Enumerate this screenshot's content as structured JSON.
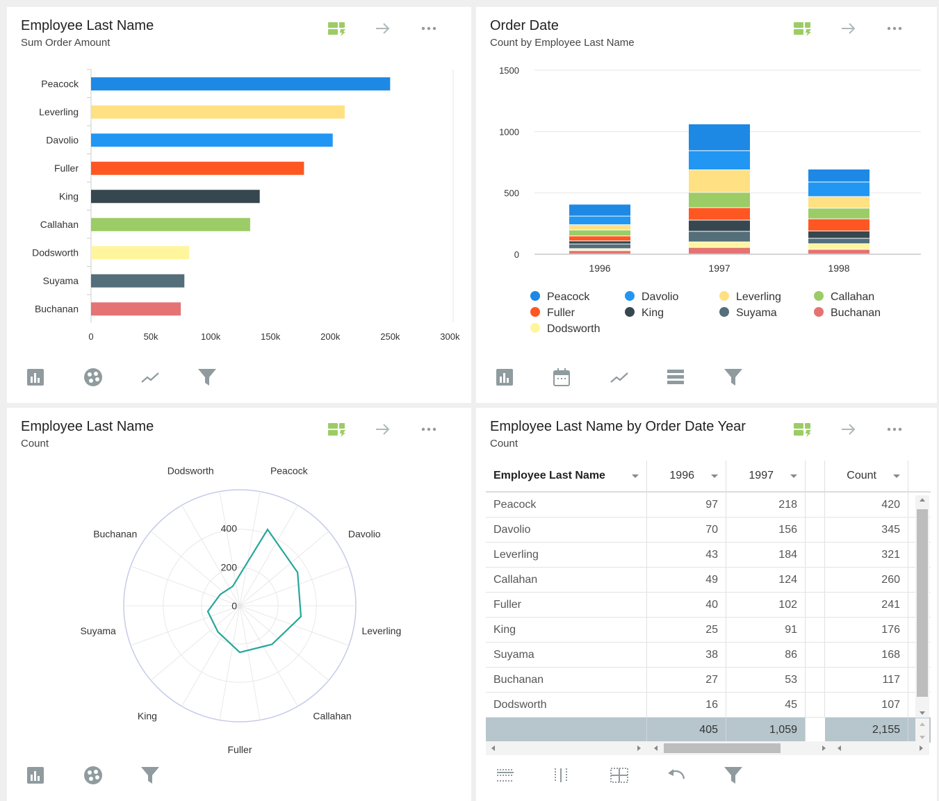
{
  "colors": {
    "Peacock": "#1e88e5",
    "Leverling": "#ffe082",
    "Davolio": "#2196f3",
    "Fuller": "#ff5722",
    "King": "#37474f",
    "Callahan": "#9ccc65",
    "Dodsworth": "#fff59d",
    "Suyama": "#546e7a",
    "Buchanan": "#e57373",
    "radar": "#26a69a",
    "icon": "#8f9b9e",
    "icon_accent": "#9ccc65"
  },
  "icons": {
    "header": [
      "visualization-settings-icon",
      "arrow-right-icon",
      "more-options-icon"
    ],
    "p1_footer": [
      "chart-type-icon",
      "palette-icon",
      "trend-icon",
      "filter-icon"
    ],
    "p2_footer": [
      "chart-type-icon",
      "calendar-icon",
      "trend-icon",
      "stack-icon",
      "filter-icon"
    ],
    "p3_footer": [
      "chart-type-icon",
      "palette-icon",
      "filter-icon"
    ],
    "p4_footer": [
      "row-grand-total-icon",
      "column-grand-total-icon",
      "grid-total-icon",
      "undo-icon",
      "filter-icon"
    ]
  },
  "panel1": {
    "title": "Employee Last Name",
    "subtitle": "Sum Order Amount",
    "chart_data": {
      "type": "bar",
      "orientation": "horizontal",
      "categories": [
        "Peacock",
        "Leverling",
        "Davolio",
        "Fuller",
        "King",
        "Callahan",
        "Dodsworth",
        "Suyama",
        "Buchanan"
      ],
      "values": [
        250000,
        212000,
        202000,
        178000,
        141000,
        133000,
        82000,
        78000,
        75000
      ],
      "xticks": [
        "0",
        "50k",
        "100k",
        "150k",
        "200k",
        "250k",
        "300k"
      ],
      "xlim": [
        0,
        300000
      ],
      "grid": false
    }
  },
  "panel2": {
    "title": "Order Date",
    "subtitle": "Count by Employee Last Name",
    "chart_data": {
      "type": "bar",
      "stacked": true,
      "categories": [
        "1996",
        "1997",
        "1998"
      ],
      "yticks": [
        "0",
        "500",
        "1000",
        "1500"
      ],
      "ylim": [
        0,
        1500
      ],
      "grid": true,
      "legend_position": "bottom",
      "series": [
        {
          "name": "Buchanan",
          "values": [
            27,
            53,
            37
          ]
        },
        {
          "name": "Dodsworth",
          "values": [
            16,
            45,
            46
          ]
        },
        {
          "name": "Suyama",
          "values": [
            38,
            86,
            44
          ]
        },
        {
          "name": "King",
          "values": [
            25,
            91,
            60
          ]
        },
        {
          "name": "Fuller",
          "values": [
            40,
            102,
            99
          ]
        },
        {
          "name": "Callahan",
          "values": [
            49,
            124,
            87
          ]
        },
        {
          "name": "Leverling",
          "values": [
            43,
            184,
            94
          ]
        },
        {
          "name": "Davolio",
          "values": [
            70,
            156,
            119
          ]
        },
        {
          "name": "Peacock",
          "values": [
            97,
            218,
            105
          ]
        }
      ],
      "legend": [
        "Peacock",
        "Davolio",
        "Leverling",
        "Callahan",
        "Fuller",
        "King",
        "Suyama",
        "Buchanan",
        "Dodsworth"
      ]
    }
  },
  "panel3": {
    "title": "Employee Last Name",
    "subtitle": "Count",
    "chart_data": {
      "type": "radar",
      "categories": [
        "Peacock",
        "Davolio",
        "Leverling",
        "Callahan",
        "Fuller",
        "King",
        "Suyama",
        "Buchanan",
        "Dodsworth"
      ],
      "values": [
        420,
        345,
        321,
        260,
        241,
        176,
        168,
        117,
        107
      ],
      "rticks": [
        "0",
        "200",
        "400"
      ],
      "rlim": [
        0,
        600
      ]
    }
  },
  "panel4": {
    "title": "Employee Last Name by Order Date Year",
    "subtitle": "Count",
    "columns": [
      "Employee Last Name",
      "1996",
      "1997",
      "Count"
    ],
    "rows": [
      [
        "Peacock",
        "97",
        "218",
        "420"
      ],
      [
        "Davolio",
        "70",
        "156",
        "345"
      ],
      [
        "Leverling",
        "43",
        "184",
        "321"
      ],
      [
        "Callahan",
        "49",
        "124",
        "260"
      ],
      [
        "Fuller",
        "40",
        "102",
        "241"
      ],
      [
        "King",
        "25",
        "91",
        "176"
      ],
      [
        "Suyama",
        "38",
        "86",
        "168"
      ],
      [
        "Buchanan",
        "27",
        "53",
        "117"
      ],
      [
        "Dodsworth",
        "16",
        "45",
        "107"
      ]
    ],
    "totals": [
      "",
      "405",
      "1,059",
      "2,155"
    ]
  }
}
